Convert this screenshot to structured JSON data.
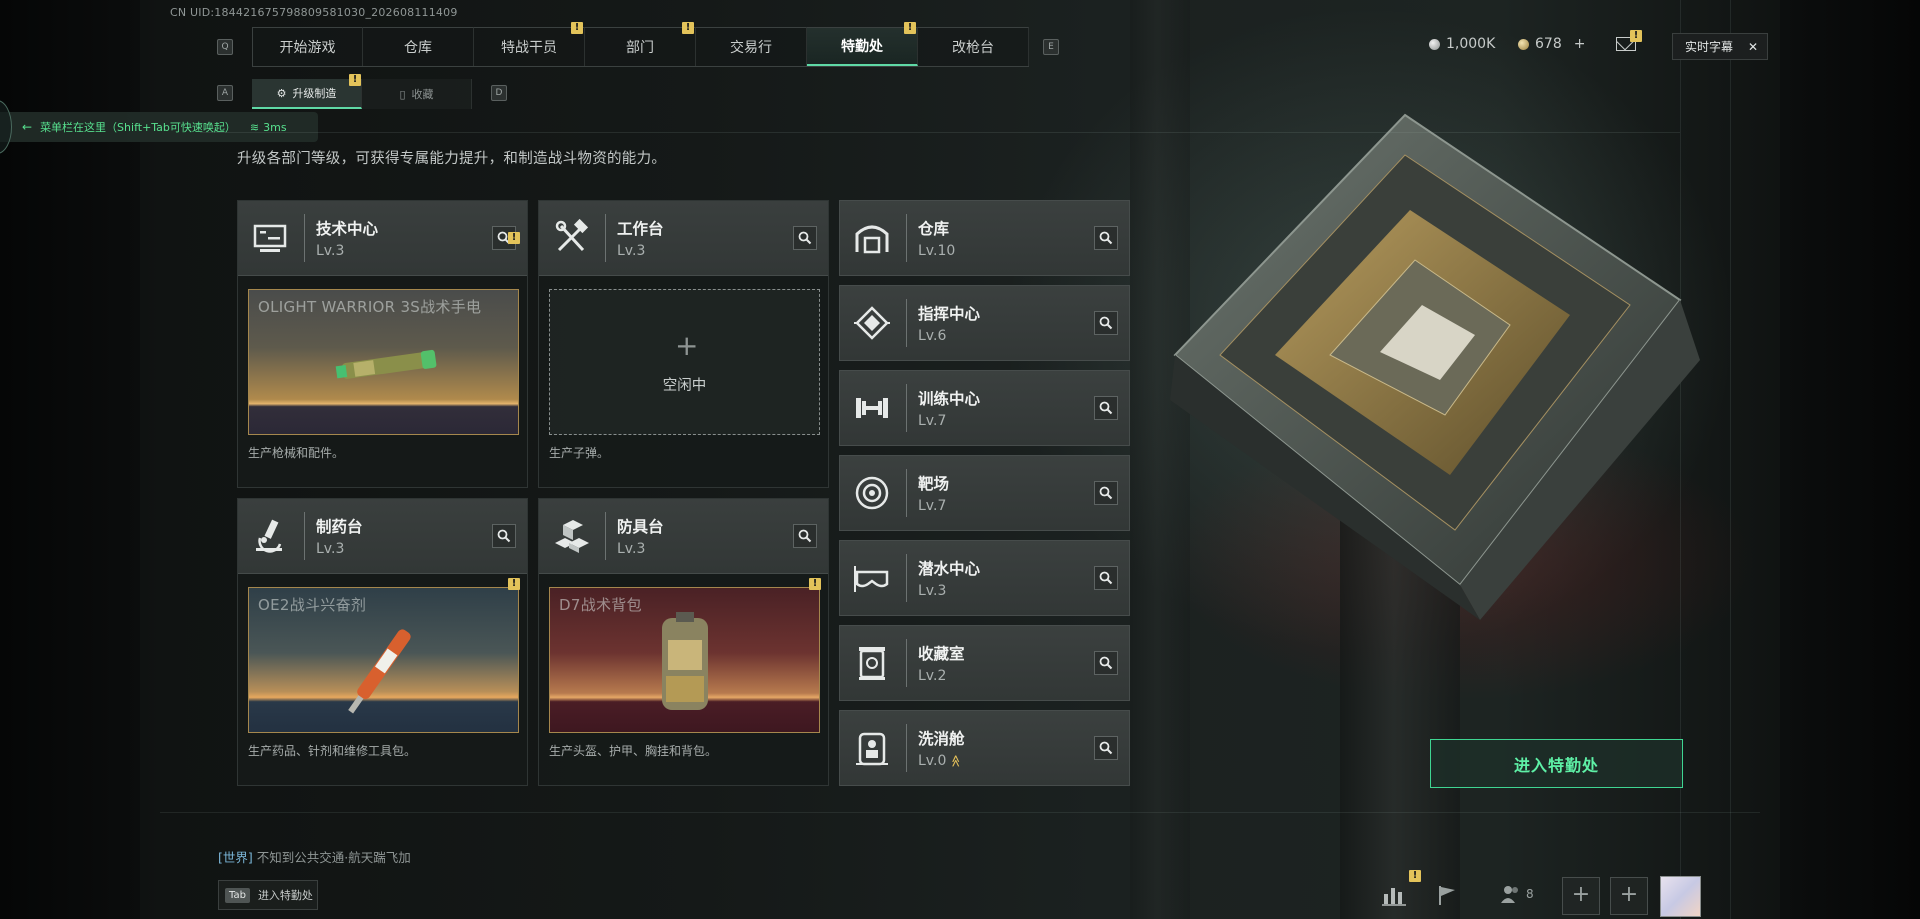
{
  "header": {
    "uid": "CN UID:18442167579880958103​0_202608111409",
    "key_left": "Q",
    "key_right": "E",
    "main_tabs": [
      {
        "label": "开始游戏",
        "badge": ""
      },
      {
        "label": "仓库",
        "badge": ""
      },
      {
        "label": "特战干员",
        "badge": "!"
      },
      {
        "label": "部门",
        "badge": "!"
      },
      {
        "label": "交易行",
        "badge": ""
      },
      {
        "label": "特勤处",
        "badge": "!",
        "active": true
      },
      {
        "label": "改枪台",
        "badge": ""
      }
    ],
    "sub_key_left": "A",
    "sub_key_right": "D",
    "sub_tabs": [
      {
        "label": "升级制造",
        "badge": "!",
        "active": true
      },
      {
        "label": "收藏",
        "badge": ""
      }
    ],
    "currency_1": "1,000K",
    "currency_2": "678",
    "currency_add": "+",
    "mail_badge": "!",
    "caption_label": "实时字幕",
    "caption_close": "✕"
  },
  "menu_hint": {
    "arrow": "←",
    "text": "菜单栏在这里（Shift+Tab可快速唤起）",
    "ping": "3ms"
  },
  "description": "升级各部门等级，可获得专属能力提升，和制造战斗物资的能力。",
  "production_cards": [
    {
      "name": "技术中心",
      "level": "Lv.3",
      "icon": "computer-icon",
      "item": "OLIGHT WARRIOR 3S战术手电",
      "badge": "!",
      "desc": "生产枪械和配件。"
    },
    {
      "name": "工作台",
      "level": "Lv.3",
      "icon": "tools-icon",
      "item": "",
      "idle_label": "空闲中",
      "plus": "+",
      "desc": "生产子弹。"
    },
    {
      "name": "制药台",
      "level": "Lv.3",
      "icon": "microscope-icon",
      "item": "OE2战斗兴奋剂",
      "badge": "!",
      "desc": "生产药品、针剂和维修工具包。"
    },
    {
      "name": "防具台",
      "level": "Lv.3",
      "icon": "armor-blocks-icon",
      "item": "D7战术背包",
      "badge": "!",
      "desc": "生产头盔、护甲、胸挂和背包。"
    }
  ],
  "list_cards": [
    {
      "name": "仓库",
      "level": "Lv.10",
      "icon": "warehouse-icon"
    },
    {
      "name": "指挥中心",
      "level": "Lv.6",
      "icon": "chip-icon"
    },
    {
      "name": "训练中心",
      "level": "Lv.7",
      "icon": "dumbbell-icon"
    },
    {
      "name": "靶场",
      "level": "Lv.7",
      "icon": "target-icon"
    },
    {
      "name": "潜水中心",
      "level": "Lv.3",
      "icon": "goggles-icon"
    },
    {
      "name": "收藏室",
      "level": "Lv.2",
      "icon": "collection-icon"
    },
    {
      "name": "洗消舱",
      "level": "Lv.0",
      "icon": "decon-icon",
      "upgrade_arrow": "≫"
    }
  ],
  "enter_button": "进入特勤处",
  "chat": {
    "channel": "[世界]",
    "message": "不知到公共交通·航天踹飞加"
  },
  "tab_hint": {
    "key": "Tab",
    "label": "进入特勤处"
  },
  "bottom": {
    "stats_badge": "!",
    "friends_count": "8",
    "add_1": "+",
    "add_2": "+"
  },
  "colors": {
    "accent_green": "#5fd9a6",
    "badge_yellow": "#e3c35a",
    "item_frame": "#a5874d"
  }
}
